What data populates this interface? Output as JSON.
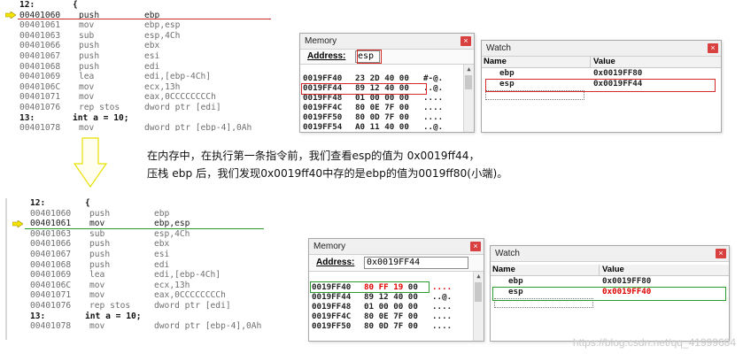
{
  "top": {
    "disasm": [
      {
        "kind": "src",
        "num": "12:",
        "text": "{"
      },
      {
        "kind": "asm",
        "addr": "00401060",
        "mn": "push",
        "op": "ebp",
        "current": true
      },
      {
        "kind": "asm",
        "addr": "00401061",
        "mn": "mov",
        "op": "ebp,esp"
      },
      {
        "kind": "asm",
        "addr": "00401063",
        "mn": "sub",
        "op": "esp,4Ch"
      },
      {
        "kind": "asm",
        "addr": "00401066",
        "mn": "push",
        "op": "ebx"
      },
      {
        "kind": "asm",
        "addr": "00401067",
        "mn": "push",
        "op": "esi"
      },
      {
        "kind": "asm",
        "addr": "00401068",
        "mn": "push",
        "op": "edi"
      },
      {
        "kind": "asm",
        "addr": "00401069",
        "mn": "lea",
        "op": "edi,[ebp-4Ch]"
      },
      {
        "kind": "asm",
        "addr": "0040106C",
        "mn": "mov",
        "op": "ecx,13h"
      },
      {
        "kind": "asm",
        "addr": "00401071",
        "mn": "mov",
        "op": "eax,0CCCCCCCCh"
      },
      {
        "kind": "asm",
        "addr": "00401076",
        "mn": "rep stos",
        "op": "dword ptr [edi]"
      },
      {
        "kind": "src",
        "num": "13:",
        "text": "int a = 10;"
      },
      {
        "kind": "asm",
        "addr": "00401078",
        "mn": "mov",
        "op": "dword ptr [ebp-4],0Ah"
      }
    ],
    "memory": {
      "title": "Memory",
      "address_label": "Address:",
      "address_value": "esp",
      "rows": [
        {
          "addr": "0019FF40",
          "bytes": "23 2D 40 00",
          "ascii": "#-@."
        },
        {
          "addr": "0019FF44",
          "bytes": "89 12 40 00",
          "ascii": "..@."
        },
        {
          "addr": "0019FF48",
          "bytes": "01 00 00 00",
          "ascii": "...."
        },
        {
          "addr": "0019FF4C",
          "bytes": "80 0E 7F 00",
          "ascii": "...."
        },
        {
          "addr": "0019FF50",
          "bytes": "80 0D 7F 00",
          "ascii": "...."
        },
        {
          "addr": "0019FF54",
          "bytes": "A0 11 40 00",
          "ascii": "..@."
        }
      ]
    },
    "watch": {
      "title": "Watch",
      "col_name": "Name",
      "col_value": "Value",
      "rows": [
        {
          "name": "ebp",
          "value": "0x0019FF80"
        },
        {
          "name": "esp",
          "value": "0x0019FF44"
        }
      ]
    }
  },
  "explanation": {
    "line1": "在内存中，在执行第一条指令前，我们查看esp的值为 0x0019ff44，",
    "line2": "压栈 ebp 后，我们发现0x0019ff40中存的是ebp的值为0019ff80(小端)。"
  },
  "bottom": {
    "disasm": [
      {
        "kind": "src",
        "num": "12:",
        "text": "{"
      },
      {
        "kind": "asm",
        "addr": "00401060",
        "mn": "push",
        "op": "ebp"
      },
      {
        "kind": "asm",
        "addr": "00401061",
        "mn": "mov",
        "op": "ebp,esp",
        "current": true
      },
      {
        "kind": "asm",
        "addr": "00401063",
        "mn": "sub",
        "op": "esp,4Ch"
      },
      {
        "kind": "asm",
        "addr": "00401066",
        "mn": "push",
        "op": "ebx"
      },
      {
        "kind": "asm",
        "addr": "00401067",
        "mn": "push",
        "op": "esi"
      },
      {
        "kind": "asm",
        "addr": "00401068",
        "mn": "push",
        "op": "edi"
      },
      {
        "kind": "asm",
        "addr": "00401069",
        "mn": "lea",
        "op": "edi,[ebp-4Ch]"
      },
      {
        "kind": "asm",
        "addr": "0040106C",
        "mn": "mov",
        "op": "ecx,13h"
      },
      {
        "kind": "asm",
        "addr": "00401071",
        "mn": "mov",
        "op": "eax,0CCCCCCCCh"
      },
      {
        "kind": "asm",
        "addr": "00401076",
        "mn": "rep stos",
        "op": "dword ptr [edi]"
      },
      {
        "kind": "src",
        "num": "13:",
        "text": "int a = 10;"
      },
      {
        "kind": "asm",
        "addr": "00401078",
        "mn": "mov",
        "op": "dword ptr [ebp-4],0Ah"
      }
    ],
    "memory": {
      "title": "Memory",
      "address_label": "Address:",
      "address_value": "0x0019FF44",
      "rows": [
        {
          "addr": "0019FF40",
          "bytes_red": "80 FF 19",
          "bytes": " 00",
          "ascii": "....",
          "ascii_red": true
        },
        {
          "addr": "0019FF44",
          "bytes": "89 12 40 00",
          "ascii": "..@."
        },
        {
          "addr": "0019FF48",
          "bytes": "01 00 00 00",
          "ascii": "...."
        },
        {
          "addr": "0019FF4C",
          "bytes": "80 0E 7F 00",
          "ascii": "...."
        },
        {
          "addr": "0019FF50",
          "bytes": "80 0D 7F 00",
          "ascii": "...."
        }
      ]
    },
    "watch": {
      "title": "Watch",
      "col_name": "Name",
      "col_value": "Value",
      "rows": [
        {
          "name": "ebp",
          "value": "0x0019FF80"
        },
        {
          "name": "esp",
          "value": "0x0019FF40",
          "red": true
        }
      ]
    }
  },
  "watermark": "https://blog.csdn.net/qq_41999684",
  "colors": {
    "highlight_red": "#d42a2a",
    "highlight_green": "#2c9c2c",
    "changed_value": "#e00000",
    "arrow_yellow": "#f4e600"
  }
}
